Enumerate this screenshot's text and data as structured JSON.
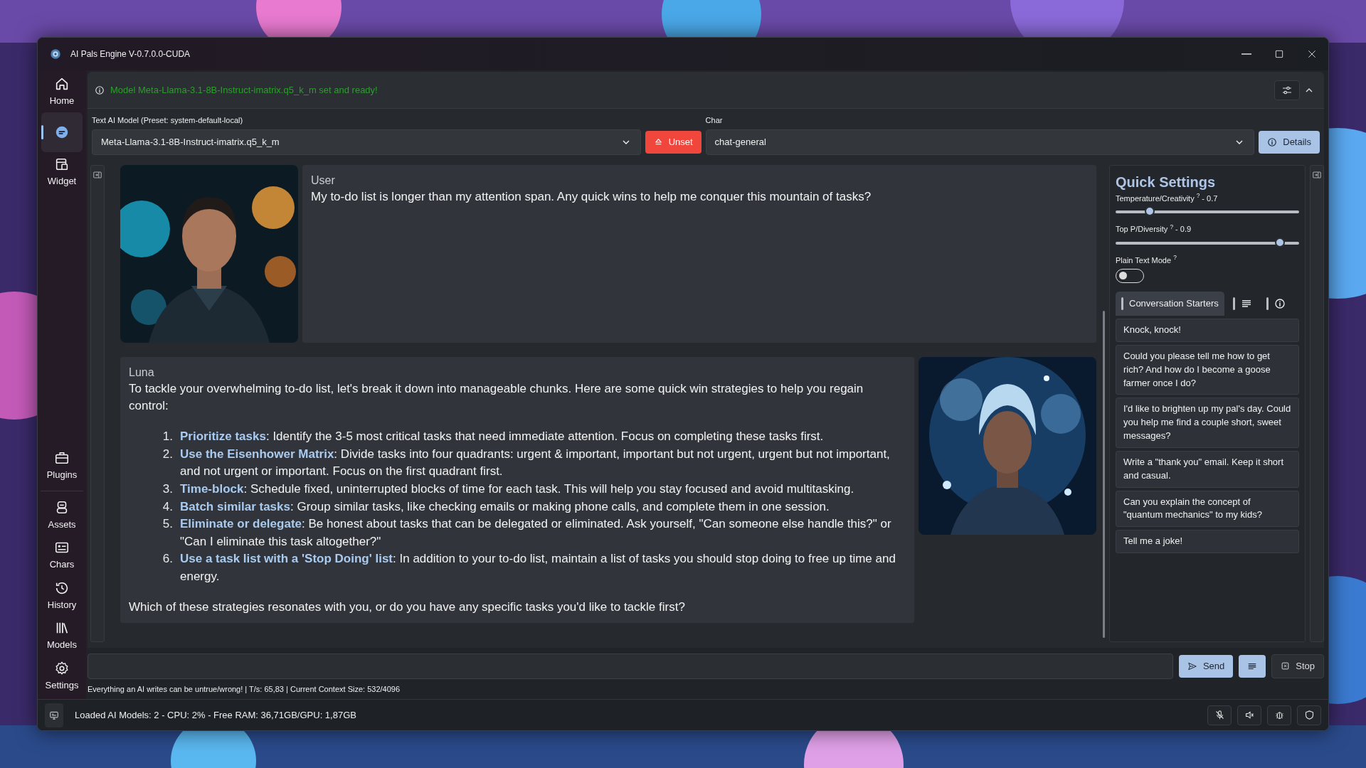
{
  "window": {
    "title": "AI Pals Engine V-0.7.0.0-CUDA"
  },
  "sidebar": {
    "top": [
      {
        "label": "Home",
        "selected": false
      },
      {
        "selected": true
      },
      {
        "label": "Widget",
        "selected": false
      }
    ],
    "middle": [
      {
        "label": "Plugins",
        "selected": false
      }
    ],
    "bottom": [
      {
        "label": "Assets",
        "selected": false
      },
      {
        "label": "Chars",
        "selected": false
      },
      {
        "label": "History",
        "selected": false
      },
      {
        "label": "Models",
        "selected": false
      },
      {
        "label": "Settings",
        "selected": false
      }
    ]
  },
  "notice": {
    "text": "Model Meta-Llama-3.1-8B-Instruct-imatrix.q5_k_m set and ready!"
  },
  "model_select": {
    "label": "Text AI Model (Preset: system-default-local)",
    "value": "Meta-Llama-3.1-8B-Instruct-imatrix.q5_k_m"
  },
  "unset_button": "Unset",
  "char_select": {
    "label": "Char",
    "value": "chat-general"
  },
  "details_button": "Details",
  "messages": [
    {
      "kind": "user",
      "sender": "User",
      "text": "My to-do list is longer than my attention span. Any quick wins to help me conquer this mountain of tasks?"
    },
    {
      "kind": "ai",
      "sender": "Luna",
      "intro": "To tackle your overwhelming to-do list, let's break it down into manageable chunks. Here are some quick win strategies to help you regain control:",
      "items": [
        {
          "number": "1.",
          "text": "**Prioritize tasks**: Identify the 3-5 most critical tasks that need immediate attention. Focus on completing these tasks first."
        },
        {
          "number": "2.",
          "text": "**Use the Eisenhower Matrix**: Divide tasks into four quadrants: urgent & important, important but not urgent, urgent but not important, and not urgent or important. Focus on the first quadrant first."
        },
        {
          "number": "3.",
          "text": "**Time-block**: Schedule fixed, uninterrupted blocks of time for each task. This will help you stay focused and avoid multitasking."
        },
        {
          "number": "4.",
          "text": "**Batch similar tasks**: Group similar tasks, like checking emails or making phone calls, and complete them in one session."
        },
        {
          "number": "5.",
          "text": "**Eliminate or delegate**: Be honest about tasks that can be delegated or eliminated. Ask yourself, \"Can someone else handle this?\" or \"Can I eliminate this task altogether?\""
        },
        {
          "number": "6.",
          "text": "**Use a task list with a 'Stop Doing' list**: In addition to your to-do list, maintain a list of tasks you should stop doing to free up time and energy."
        }
      ],
      "outro": "Which of these strategies resonates with you, or do you have any specific tasks you'd like to tackle first?"
    }
  ],
  "quick_settings": {
    "title": "Quick Settings",
    "sliders": [
      {
        "label": "Temperature/Creativity $^{?}$ -",
        "reading": "0.7",
        "level": 0.17
      },
      {
        "label": "Top P/Diversity $^{?}$ -",
        "reading": "0.9",
        "level": 0.92
      }
    ],
    "toggle": {
      "label": "Plain Text Mode $^{?}$",
      "on": false
    },
    "tabs": [
      {
        "kind": "text",
        "label": "Conversation Starters",
        "selected": true
      },
      {
        "kind": "list",
        "selected": false
      },
      {
        "kind": "info",
        "selected": false
      }
    ],
    "starters": [
      "Knock, knock!",
      "Could you please tell me how to get rich? And how do I become a goose farmer once I do?",
      "I'd like to brighten up my pal's day. Could you help me find a couple short, sweet messages?",
      "Write a \"thank you\" email. Keep it short and casual.",
      "Can you explain the concept of \"quantum mechanics\" to my kids?",
      "Tell me a joke!"
    ]
  },
  "send_button": "Send",
  "stop_button": "Stop",
  "footer_note": "Everything an AI writes can be untrue/wrong! | T/s: 65,83 | Current Context Size: 532/4096",
  "status_bar": {
    "text": "Loaded AI Models: 2 - CPU: 2% - Free RAM: 36,71GB/GPU: 1,87GB"
  }
}
